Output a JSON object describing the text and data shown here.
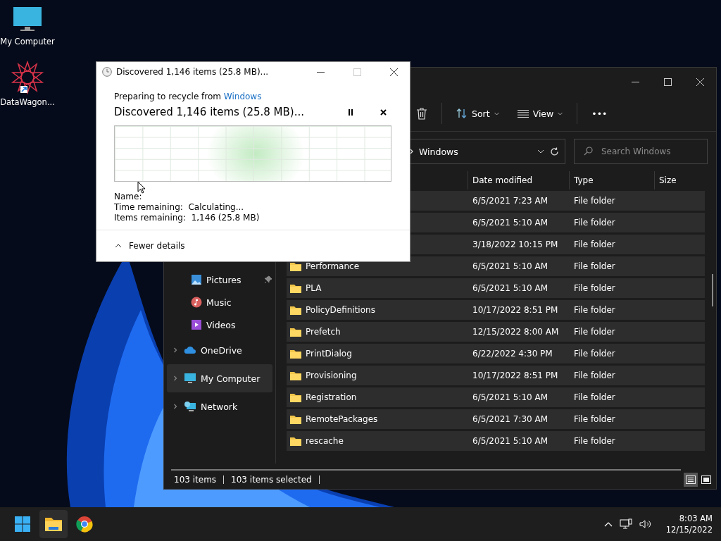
{
  "desktop_icons": [
    {
      "kind": "computer",
      "label": "My Computer"
    },
    {
      "kind": "app",
      "label": "DataWagon..."
    }
  ],
  "explorer": {
    "toolbar": {
      "sort": "Sort",
      "view": "View",
      "more": "•••"
    },
    "address": {
      "path": "Windows"
    },
    "search": {
      "placeholder": "Search Windows"
    },
    "columns": [
      "Date modified",
      "Type",
      "Size"
    ],
    "sidebar": [
      {
        "kind": "pictures",
        "label": "Pictures",
        "pinned": true,
        "expandable": false,
        "selected": false
      },
      {
        "kind": "music",
        "label": "Music",
        "pinned": false,
        "expandable": false,
        "selected": false
      },
      {
        "kind": "videos",
        "label": "Videos",
        "pinned": false,
        "expandable": false,
        "selected": false
      },
      {
        "kind": "cloud",
        "label": "OneDrive",
        "pinned": false,
        "expandable": true,
        "selected": false
      },
      {
        "kind": "computer",
        "label": "My Computer",
        "pinned": false,
        "expandable": true,
        "selected": true
      },
      {
        "kind": "network",
        "label": "Network",
        "pinned": false,
        "expandable": true,
        "selected": false
      }
    ],
    "rows": [
      {
        "date": "6/5/2021 7:23 AM",
        "type": "File folder",
        "selected": true
      },
      {
        "date": "6/5/2021 5:10 AM",
        "type": "File folder",
        "selected": true
      },
      {
        "date": "3/18/2022 10:15 PM",
        "type": "File folder",
        "selected": true
      },
      {
        "name": "Performance",
        "date": "6/5/2021 5:10 AM",
        "type": "File folder",
        "selected": true
      },
      {
        "name": "PLA",
        "date": "6/5/2021 5:10 AM",
        "type": "File folder",
        "selected": true
      },
      {
        "name": "PolicyDefinitions",
        "date": "10/17/2022 8:51 PM",
        "type": "File folder",
        "selected": true
      },
      {
        "name": "Prefetch",
        "date": "12/15/2022 8:00 AM",
        "type": "File folder",
        "selected": true
      },
      {
        "name": "PrintDialog",
        "date": "6/22/2022 4:30 PM",
        "type": "File folder",
        "selected": true
      },
      {
        "name": "Provisioning",
        "date": "10/17/2022 8:51 PM",
        "type": "File folder",
        "selected": true
      },
      {
        "name": "Registration",
        "date": "6/5/2021 5:10 AM",
        "type": "File folder",
        "selected": true
      },
      {
        "name": "RemotePackages",
        "date": "6/5/2021 7:30 AM",
        "type": "File folder",
        "selected": true
      },
      {
        "name": "rescache",
        "date": "6/5/2021 5:10 AM",
        "type": "File folder",
        "selected": true
      }
    ],
    "status_bar": {
      "count": "103 items",
      "selection": "103 items selected"
    }
  },
  "dialog": {
    "title": "Discovered 1,146 items (25.8 MB)...",
    "subtitle": "Preparing to recycle from",
    "source_link": "Windows",
    "heading": "Discovered 1,146 items (25.8 MB)...",
    "details": [
      {
        "label": "Name:"
      },
      {
        "label": "Time remaining:",
        "value": "Calculating..."
      },
      {
        "label": "Items remaining:",
        "value": "1,146 (25.8 MB)"
      }
    ],
    "toggle": "Fewer details"
  },
  "taskbar": {
    "apps": [
      {
        "kind": "start",
        "selected": false
      },
      {
        "kind": "explorer",
        "selected": true
      },
      {
        "kind": "chrome",
        "selected": false
      }
    ],
    "time": "8:03 AM",
    "date": "12/15/2022"
  }
}
